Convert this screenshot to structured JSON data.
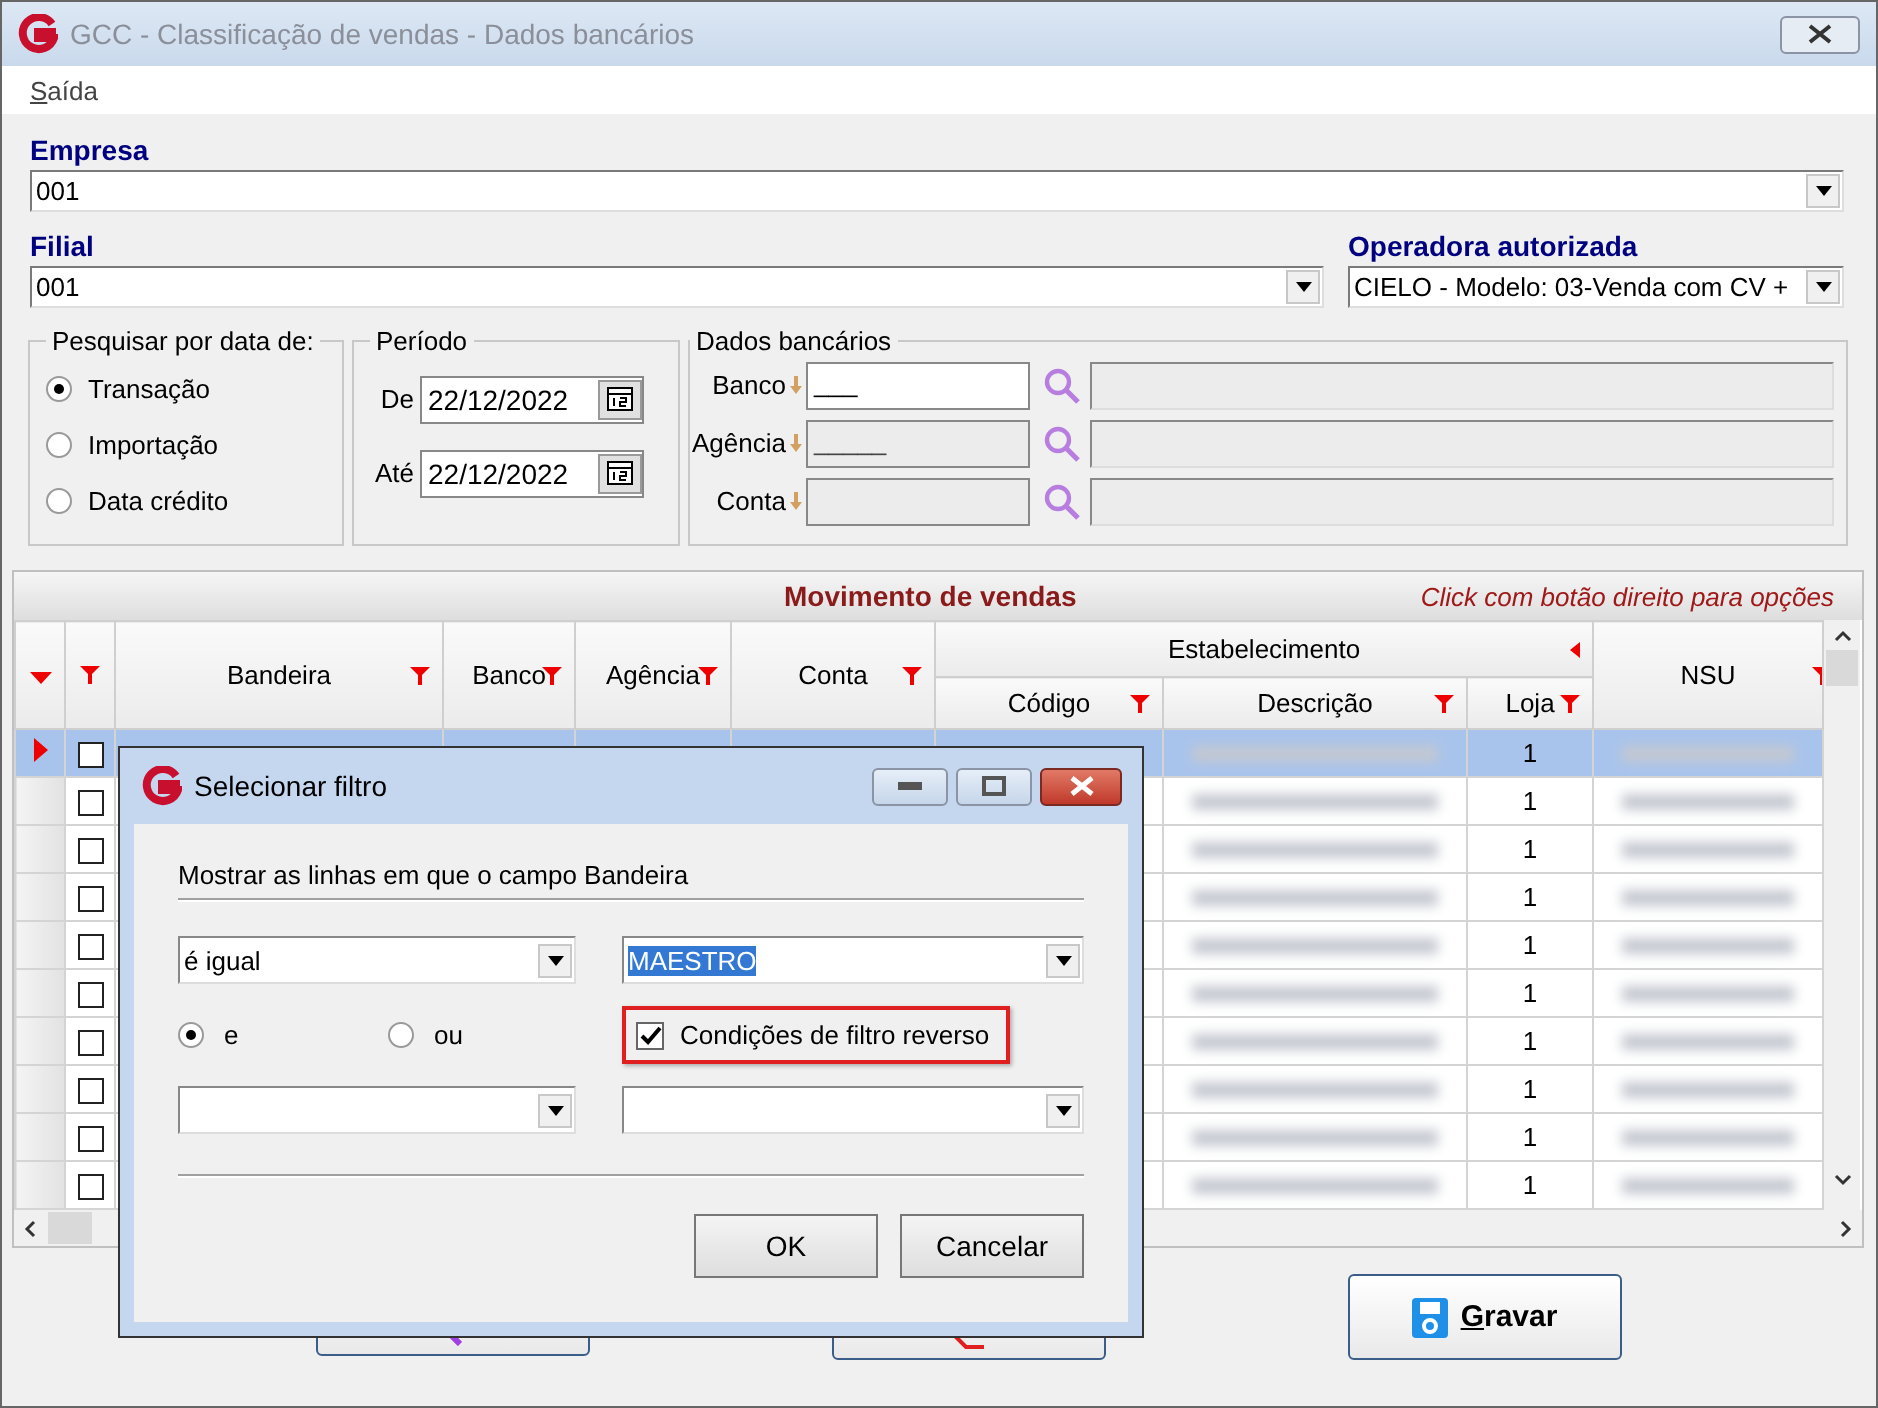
{
  "window": {
    "title": "GCC - Classificação de vendas - Dados bancários"
  },
  "menu": [
    {
      "label": "Saída"
    }
  ],
  "empresa": {
    "label": "Empresa",
    "value": "001"
  },
  "filial": {
    "label": "Filial",
    "value": "001"
  },
  "operadora": {
    "label": "Operadora autorizada",
    "value": "CIELO - Modelo: 03-Venda com CV +"
  },
  "date_type": {
    "legend": "Pesquisar por data de:",
    "options": [
      {
        "label": "Transação",
        "selected": true
      },
      {
        "label": "Importação",
        "selected": false
      },
      {
        "label": "Data crédito",
        "selected": false
      }
    ]
  },
  "periodo": {
    "legend": "Período",
    "fields": [
      {
        "label": "De",
        "value": "22/12/2022"
      },
      {
        "label": "Até",
        "value": "22/12/2022"
      }
    ]
  },
  "dados_bancarios": {
    "legend": "Dados bancários",
    "fields": [
      {
        "label": "Banco",
        "value": "___",
        "disabled": false
      },
      {
        "label": "Agência",
        "value": "_____",
        "disabled": true
      },
      {
        "label": "Conta",
        "disabled": true
      }
    ]
  },
  "grid": {
    "title": "Movimento de vendas",
    "hint": "Click com botão direito para opções",
    "group": "Estabelecimento",
    "columns": [
      "Bandeira",
      "Banco",
      "Agência",
      "Conta",
      "Código",
      "Descrição",
      "Loja",
      "NSU"
    ],
    "rows": [
      {
        "selected": true,
        "checked": false,
        "loja": "1"
      },
      {
        "selected": false,
        "checked": false,
        "loja": "1"
      },
      {
        "selected": false,
        "checked": false,
        "loja": "1"
      },
      {
        "selected": false,
        "checked": false,
        "loja": "1"
      },
      {
        "selected": false,
        "checked": false,
        "loja": "1"
      },
      {
        "selected": false,
        "checked": false,
        "loja": "1"
      },
      {
        "selected": false,
        "checked": false,
        "loja": "1"
      },
      {
        "selected": false,
        "checked": false,
        "loja": "1"
      },
      {
        "selected": false,
        "checked": false,
        "loja": "1"
      },
      {
        "selected": false,
        "checked": false,
        "loja": "1"
      }
    ]
  },
  "actions": [
    {
      "kind": "search"
    },
    {
      "kind": "clear"
    },
    {
      "kind": "save",
      "label": "Gravar"
    }
  ],
  "dialog": {
    "title": "Selecionar filtro",
    "prompt": "Mostrar as linhas em que o campo Bandeira",
    "operator": "é igual",
    "value": "MAESTRO",
    "logic": [
      {
        "label": "e",
        "selected": true
      },
      {
        "label": "ou",
        "selected": false
      }
    ],
    "reverse": {
      "label": "Condições de filtro reverso",
      "checked": true
    },
    "buttons": [
      "OK",
      "Cancelar"
    ]
  }
}
